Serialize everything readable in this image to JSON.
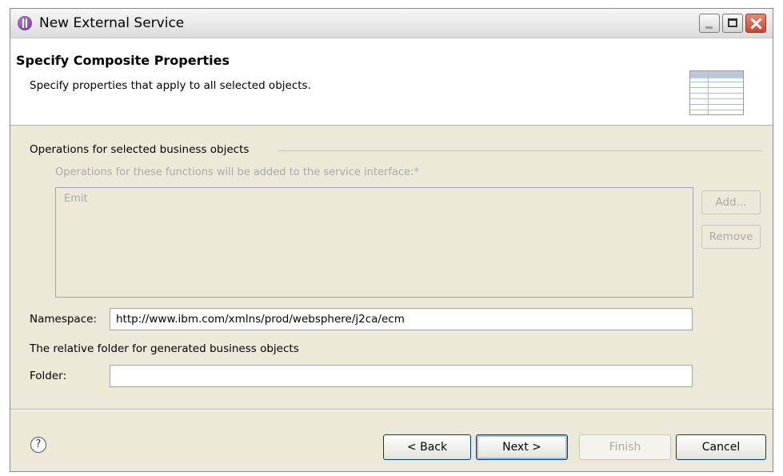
{
  "window": {
    "title": "New External Service"
  },
  "banner": {
    "title": "Specify Composite Properties",
    "description": "Specify properties that apply to all selected objects."
  },
  "operations": {
    "group_label": "Operations for selected business objects",
    "list_label": "Operations for these functions will be added to the service interface:*",
    "items": [
      "Emit"
    ],
    "add_label": "Add...",
    "remove_label": "Remove"
  },
  "namespace": {
    "label": "Namespace:",
    "value": "http://www.ibm.com/xmlns/prod/websphere/j2ca/ecm"
  },
  "relative_folder_label": "The relative folder for generated business objects",
  "folder": {
    "label": "Folder:",
    "value": ""
  },
  "footer": {
    "help_glyph": "?",
    "back_label": "< Back",
    "next_label": "Next >",
    "finish_label": "Finish",
    "cancel_label": "Cancel"
  },
  "colors": {
    "window_bg": "#ece9d8",
    "disabled_text": "#a9a9a9",
    "button_border": "#003c74",
    "close_button": "#c7472c"
  },
  "icons": {
    "app": "eclipse-app-icon",
    "banner": "table-properties-icon",
    "help": "help-icon"
  }
}
